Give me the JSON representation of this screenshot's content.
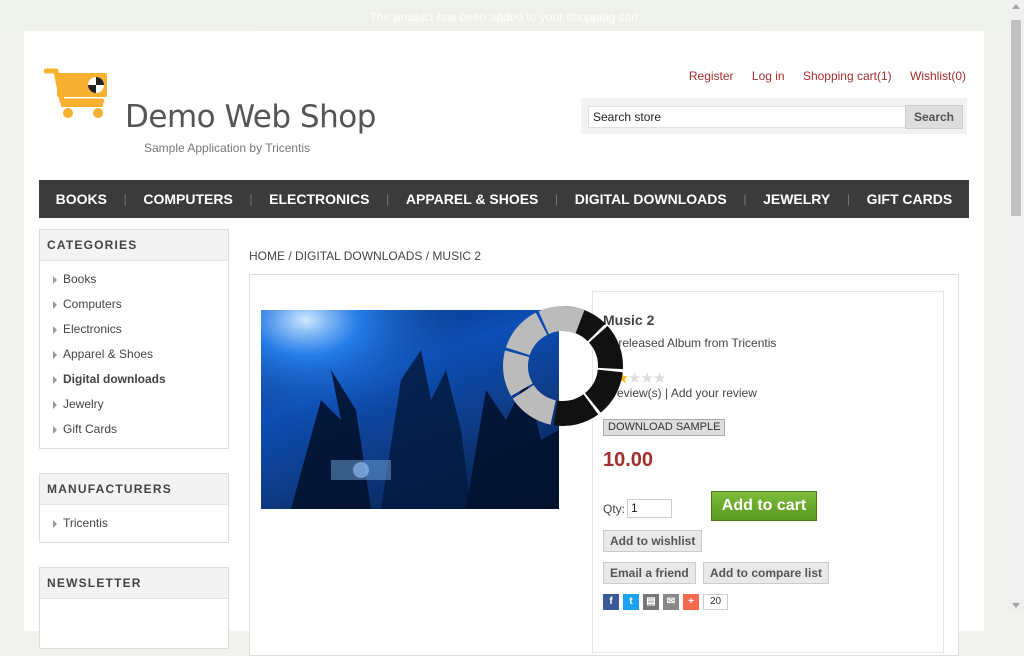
{
  "notification": "The product has been added to your shopping cart",
  "logo": {
    "title": "Demo Web Shop",
    "subtitle": "Sample Application by Tricentis"
  },
  "header_links": {
    "register": "Register",
    "login": "Log in",
    "cart": "Shopping cart(1)",
    "wishlist": "Wishlist(0)"
  },
  "search": {
    "value": "Search store",
    "button": "Search"
  },
  "top_menu": [
    "BOOKS",
    "COMPUTERS",
    "ELECTRONICS",
    "APPAREL & SHOES",
    "DIGITAL DOWNLOADS",
    "JEWELRY",
    "GIFT CARDS"
  ],
  "categories": {
    "title": "CATEGORIES",
    "items": [
      "Books",
      "Computers",
      "Electronics",
      "Apparel & Shoes",
      "Digital downloads",
      "Jewelry",
      "Gift Cards"
    ],
    "active_index": 4
  },
  "manufacturers": {
    "title": "MANUFACTURERS",
    "items": [
      "Tricentis"
    ]
  },
  "newsletter": {
    "title": "NEWSLETTER"
  },
  "breadcrumb": {
    "home": "HOME",
    "category": "DIGITAL DOWNLOADS",
    "current": "MUSIC 2",
    "sep": "/"
  },
  "product": {
    "name": "Music 2",
    "short_description": "Unreleased Album from Tricentis",
    "rating_stars": 2,
    "rating_max": 5,
    "reviews_link": "2 review(s)",
    "review_sep": "|",
    "add_review": "Add your review",
    "download_sample": "DOWNLOAD SAMPLE",
    "price": "10.00",
    "qty_label": "Qty:",
    "qty_value": "1",
    "add_to_cart": "Add to cart",
    "add_to_wishlist": "Add to wishlist",
    "email_friend": "Email a friend",
    "add_to_compare": "Add to compare list",
    "share_count": "20"
  },
  "colors": {
    "accent": "#a42e2e",
    "menu_bg": "#3b3b3b",
    "cart_button": "#6aa92b",
    "logo_orange": "#f7b030"
  }
}
